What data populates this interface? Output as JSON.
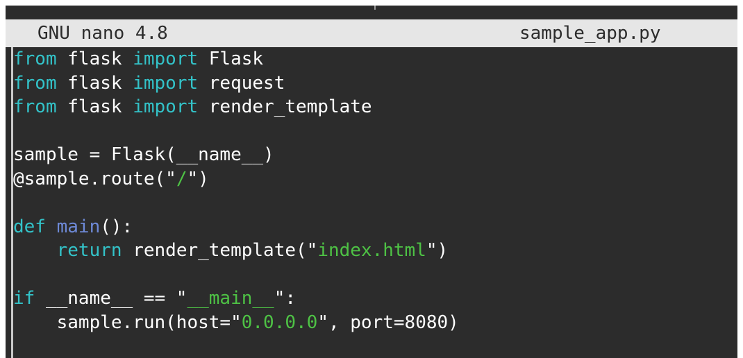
{
  "titlebar": {
    "app": "GNU nano 4.8",
    "file": "sample_app.py"
  },
  "code": {
    "l1": {
      "a": "from",
      "b": " flask ",
      "c": "import",
      "d": " Flask"
    },
    "l2": {
      "a": "from",
      "b": " flask ",
      "c": "import",
      "d": " request"
    },
    "l3": {
      "a": "from",
      "b": " flask ",
      "c": "import",
      "d": " render_template"
    },
    "l5": {
      "a": "sample = Flask(__name__)"
    },
    "l6": {
      "a": "@sample.route(\"",
      "b": "/",
      "c": "\")"
    },
    "l8": {
      "a": "def",
      "b": " ",
      "c": "main",
      "d": "():"
    },
    "l9": {
      "a": "    ",
      "b": "return",
      "c": " render_template(\"",
      "d": "index.html",
      "e": "\")"
    },
    "l11": {
      "a": "if",
      "b": " __name__ == \"",
      "c": "__main__",
      "d": "\":"
    },
    "l12": {
      "a": "    sample.run(host=\"",
      "b": "0.0.0.0",
      "c": "\", port=8080)"
    }
  },
  "colors": {
    "background": "#2c2c2c",
    "titlebar": "#e6e6e6",
    "keyword": "#33c3c9",
    "function": "#6e8ad8",
    "string": "#4ec245"
  }
}
